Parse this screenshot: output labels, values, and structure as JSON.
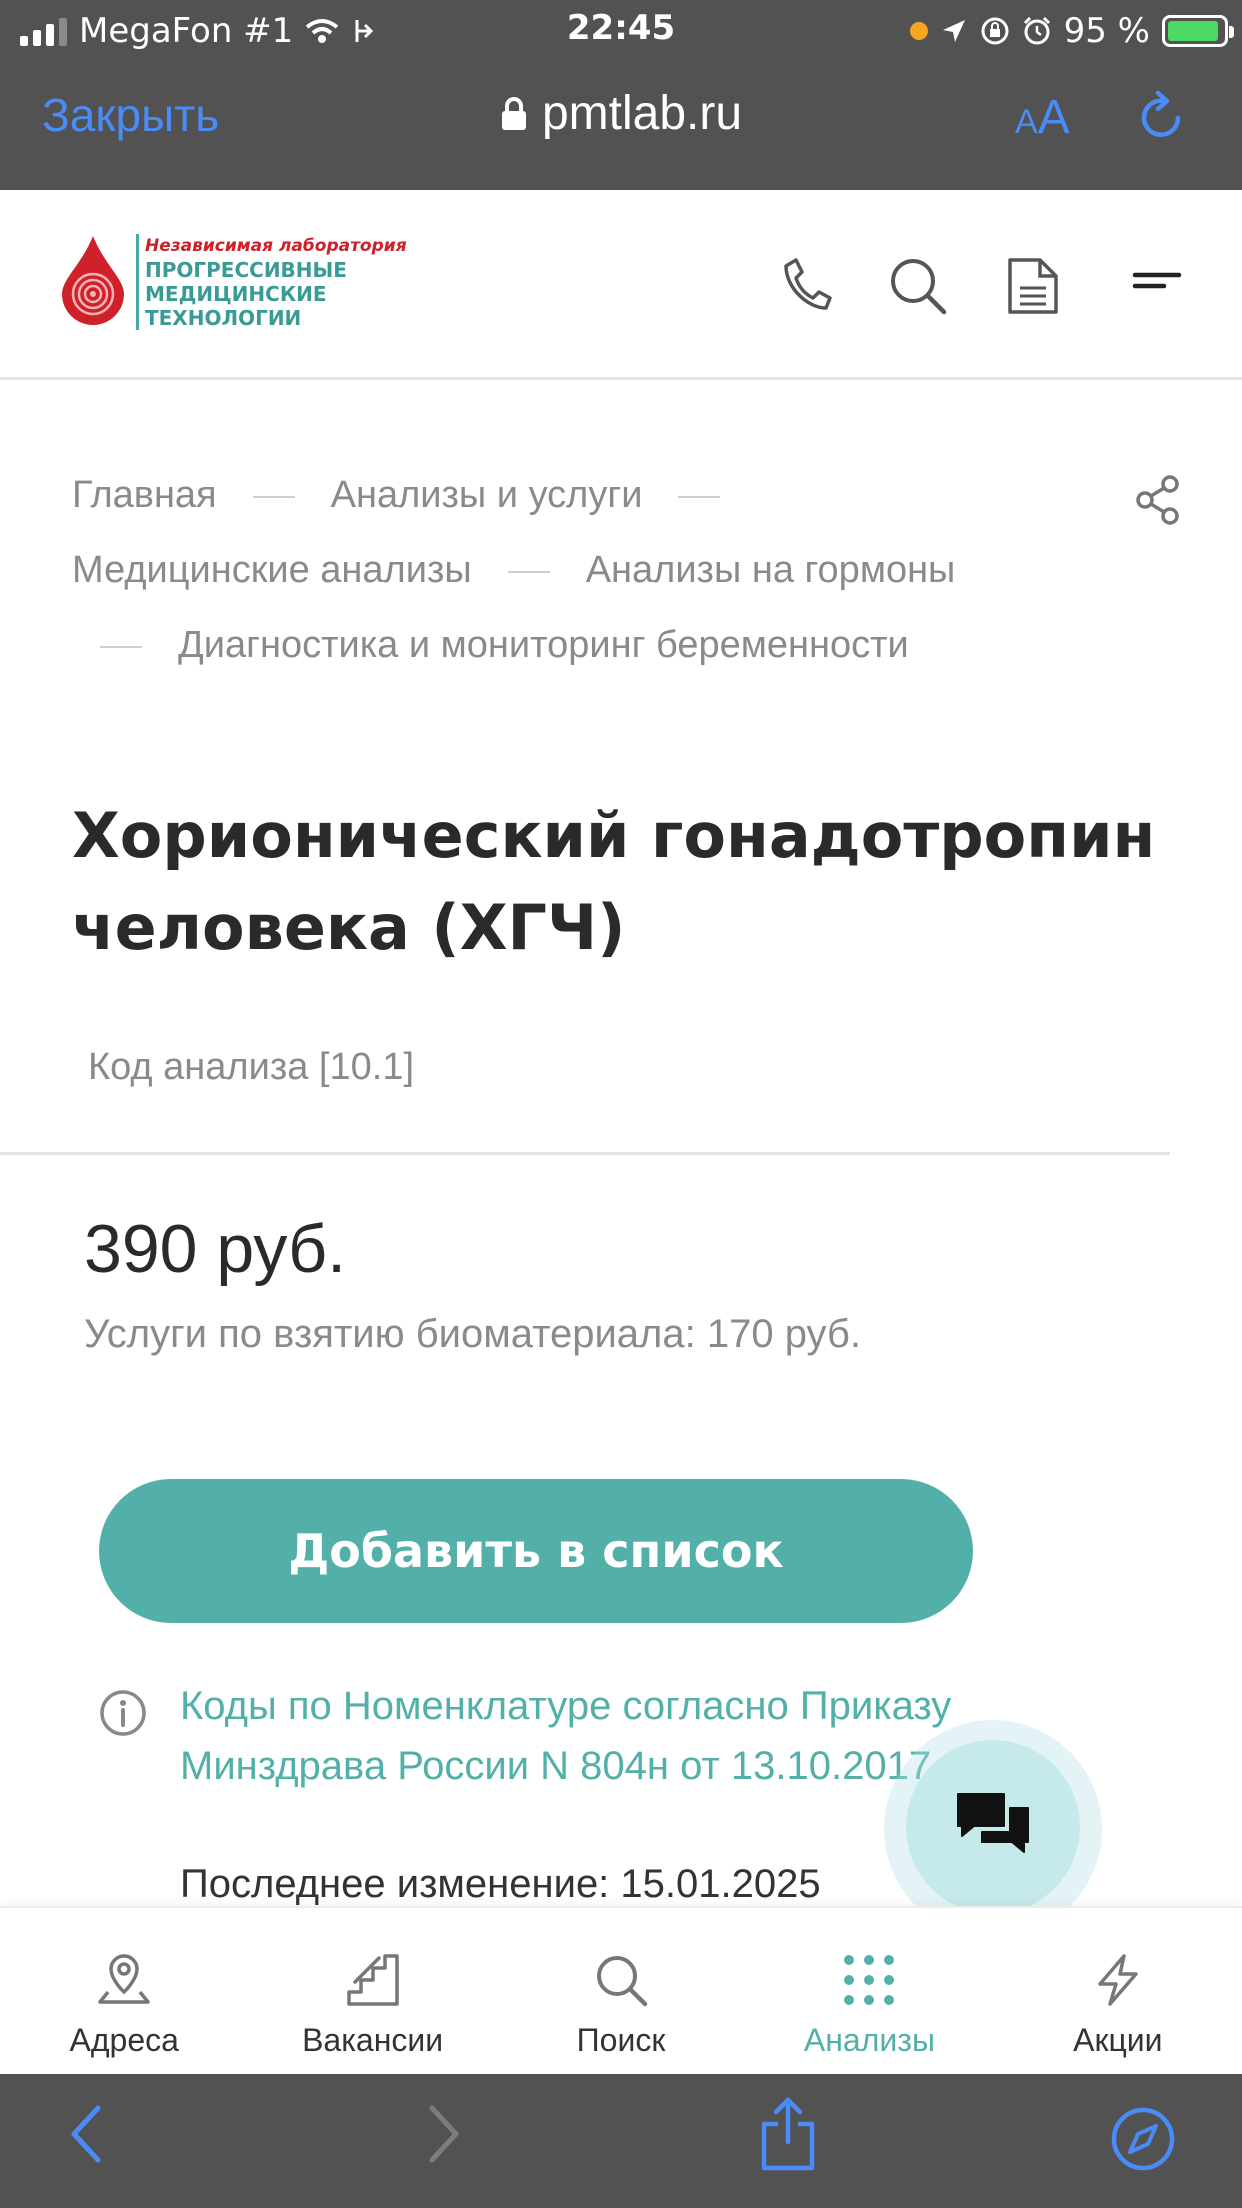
{
  "status_bar": {
    "carrier": "MegaFon #1",
    "time": "22:45",
    "battery": "95 %",
    "battery_level": 0.95,
    "icons": [
      "signal-icon",
      "wifi-icon",
      "call-forward-icon",
      "location-icon",
      "rotation-lock-icon",
      "alarm-icon",
      "battery-icon"
    ]
  },
  "browser": {
    "close_label": "Закрыть",
    "url": "pmtlab.ru",
    "text_size_small": "A",
    "text_size_big": "A"
  },
  "logo": {
    "line1": "Независимая лаборатория",
    "line2": "ПРОГРЕССИВНЫЕ",
    "line3": "МЕДИЦИНСКИЕ",
    "line4": "ТЕХНОЛОГИИ"
  },
  "breadcrumb": [
    "Главная",
    "Анализы и услуги",
    "Медицинские анализы",
    "Анализы на гормоны",
    "Диагностика и мониторинг беременности"
  ],
  "title_line1": "Хорионический гонадотропин",
  "title_line2": "человека (ХГЧ)",
  "code": "Код анализа [10.1]",
  "price": "390 руб.",
  "service_price": "Услуги по взятию биоматериала: 170 руб.",
  "add_button": "Добавить в список",
  "nomenclature_line1": "Коды по Номенклатуре согласно Приказу",
  "nomenclature_line2": "Минздрава России N 804н от 13.10.2017",
  "last_change": "Последнее изменение: 15.01.2025",
  "nav": [
    {
      "label": "Адреса",
      "icon": "map-pin-icon"
    },
    {
      "label": "Вакансии",
      "icon": "stairs-icon"
    },
    {
      "label": "Поиск",
      "icon": "search-icon"
    },
    {
      "label": "Анализы",
      "icon": "grid-dots-icon",
      "active": true
    },
    {
      "label": "Акции",
      "icon": "lightning-icon"
    }
  ],
  "colors": {
    "accent": "#52b0a8",
    "browser_chrome": "#525252",
    "ios_blue": "#4a8cf7",
    "logo_red": "#d0202a"
  }
}
